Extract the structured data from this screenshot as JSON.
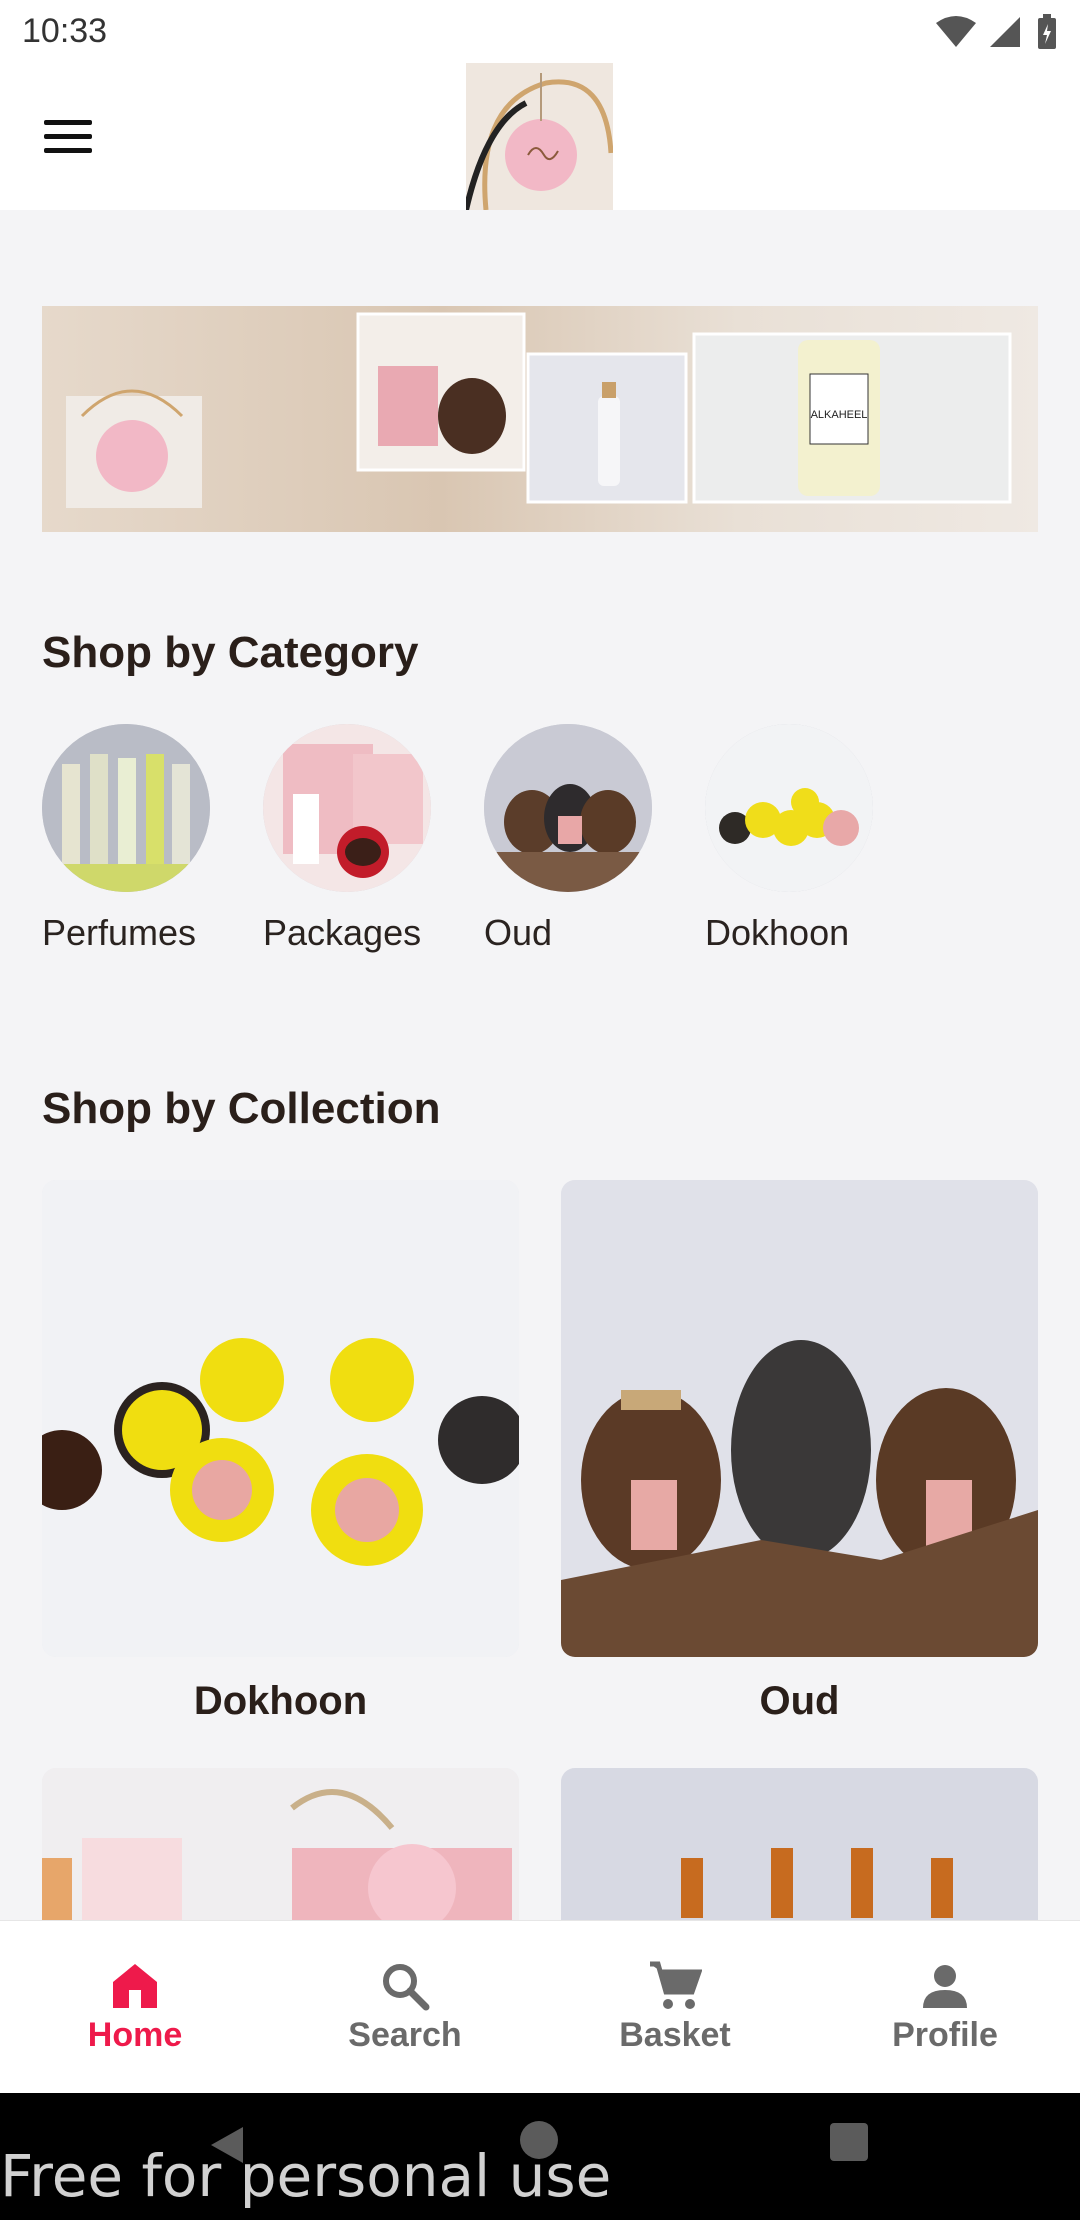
{
  "status_bar": {
    "time": "10:33"
  },
  "header": {
    "menu_icon": "hamburger-menu-icon",
    "logo_alt": "Al Kaheel logo"
  },
  "banner": {
    "label_text": "ALKAHEEL"
  },
  "categories": {
    "title": "Shop by Category",
    "items": [
      {
        "label": "Perfumes"
      },
      {
        "label": "Packages"
      },
      {
        "label": "Oud"
      },
      {
        "label": "Dokhoon"
      }
    ]
  },
  "collections": {
    "title": "Shop by Collection",
    "items": [
      {
        "label": "Dokhoon"
      },
      {
        "label": "Oud"
      }
    ]
  },
  "bottom_nav": {
    "active_color": "#ee1a4b",
    "items": [
      {
        "label": "Home",
        "icon": "home-icon",
        "active": true
      },
      {
        "label": "Search",
        "icon": "search-icon",
        "active": false
      },
      {
        "label": "Basket",
        "icon": "cart-icon",
        "active": false
      },
      {
        "label": "Profile",
        "icon": "person-icon",
        "active": false
      }
    ]
  },
  "watermark": "Free for personal use"
}
